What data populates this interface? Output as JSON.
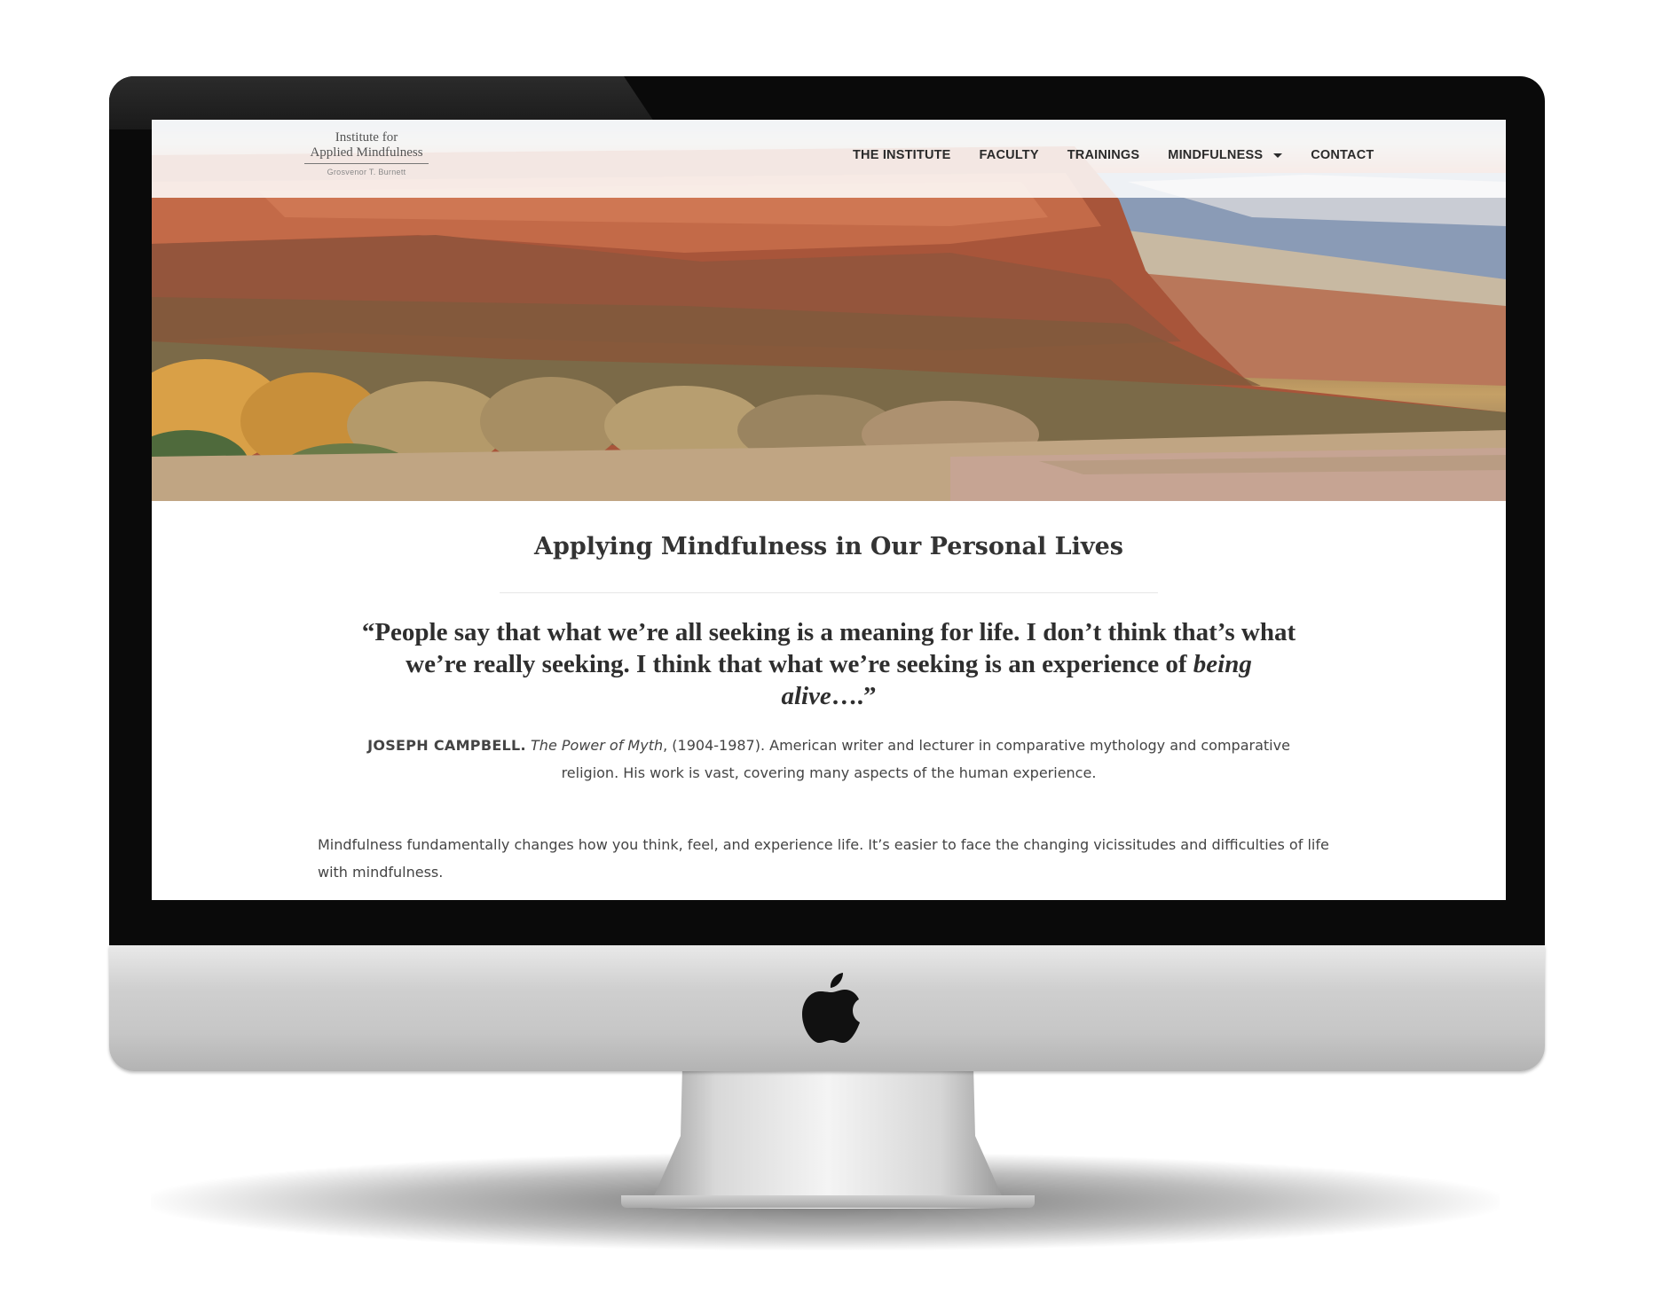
{
  "site": {
    "logo": {
      "line1": "Institute for",
      "line2": "Applied Mindfulness",
      "tagline": "Grosvenor T. Burnett"
    },
    "nav": {
      "items": [
        {
          "label": "THE INSTITUTE"
        },
        {
          "label": "FACULTY"
        },
        {
          "label": "TRAININGS"
        },
        {
          "label": "MINDFULNESS",
          "has_dropdown": true
        },
        {
          "label": "CONTACT"
        }
      ]
    },
    "hero": {
      "alt_description": "Red rock mesa and canyon landscape with autumn trees"
    }
  },
  "main": {
    "title": "Applying Mindfulness in Our Personal Lives",
    "quote": {
      "text": "“People say that what we’re all seeking is a meaning for life. I don’t think that’s what we’re really seeking. I think that what we’re seeking is an experience of",
      "emphasis": "being alive",
      "ending": "….”"
    },
    "attribution": {
      "name": "JOSEPH CAMPBELL.",
      "work": "The Power of Myth",
      "details": ", (1904-1987). American writer and lecturer in comparative mythology and comparative religion. His work is vast, covering many aspects of the human experience."
    },
    "paragraph": "Mindfulness fundamentally changes how you think, feel, and experience life. It’s easier to face the changing vicissitudes and difficulties of life with mindfulness."
  },
  "device": {
    "logo_icon": "apple-logo-icon"
  },
  "colors": {
    "nav_text": "#2a2a2a",
    "heading": "#333333",
    "body_text": "#444444",
    "bezel": "#0a0a0a"
  }
}
